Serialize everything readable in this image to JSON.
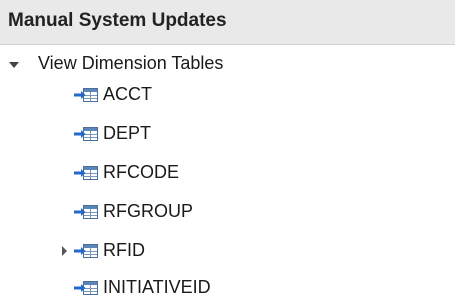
{
  "panel": {
    "title": "Manual System Updates"
  },
  "tree": {
    "root": {
      "label": "View Dimension Tables",
      "expanded": true,
      "icon": "chevron-down-icon"
    },
    "items": [
      {
        "label": "ACCT",
        "icon": "table-link-icon",
        "has_children": false
      },
      {
        "label": "DEPT",
        "icon": "table-link-icon",
        "has_children": false
      },
      {
        "label": "RFCODE",
        "icon": "table-link-icon",
        "has_children": false
      },
      {
        "label": "RFGROUP",
        "icon": "table-link-icon",
        "has_children": false
      },
      {
        "label": "RFID",
        "icon": "table-link-icon",
        "has_children": true,
        "expanded": false
      },
      {
        "label": "INITIATIVEID",
        "icon": "table-link-icon",
        "has_children": false
      }
    ]
  },
  "colors": {
    "header_background": "#e9e9e9",
    "icon_arrow": "#2468c8",
    "icon_table_header": "#5b87b8"
  }
}
